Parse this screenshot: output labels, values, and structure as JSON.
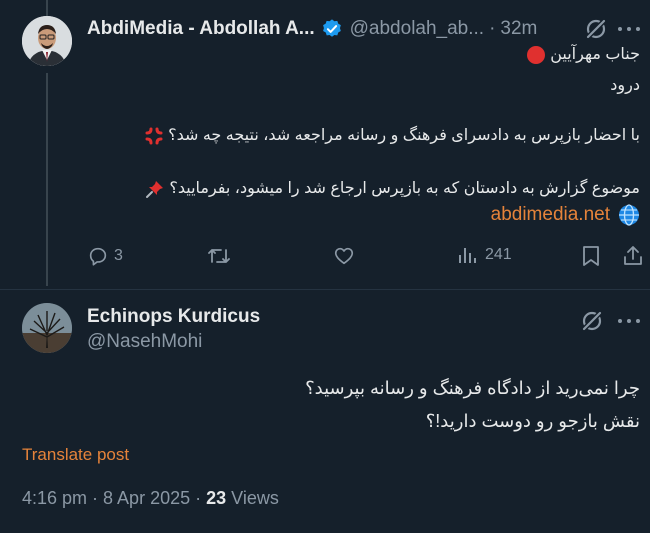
{
  "tweet1": {
    "display_name": "AbdiMedia - Abdollah A...",
    "handle": "@abdolah_ab...",
    "dot": "·",
    "time": "32m",
    "lines": [
      "جناب مهرآیین",
      "درود",
      "با احضار بازپرس به دادسرای فرهنگ و رسانه مراجعه شد، نتیجه چه شد؟",
      "موضوع گزارش به دادستان که به بازپرس ارجاع شد را میشود، بفرمایید؟"
    ],
    "link": "abdimedia.net",
    "actions": {
      "replies": "3",
      "retweets": "",
      "likes": "",
      "views": "241"
    }
  },
  "tweet2": {
    "display_name": "Echinops Kurdicus",
    "handle": "@NasehMohi",
    "lines": [
      "چرا نمی‌رید از دادگاه فرهنگ و رسانه بپرسید؟",
      "نقش بازجو رو دوست دارید!؟"
    ],
    "translate_label": "Translate post",
    "meta_time": "4:16 pm · 8 Apr 2025 · ",
    "meta_views_count": "23",
    "meta_views_label": " Views"
  },
  "colors": {
    "background": "#15202b",
    "text": "#e7e9ea",
    "muted": "#8b98a5",
    "link": "#e5833a",
    "verified": "#1d9bf0"
  }
}
